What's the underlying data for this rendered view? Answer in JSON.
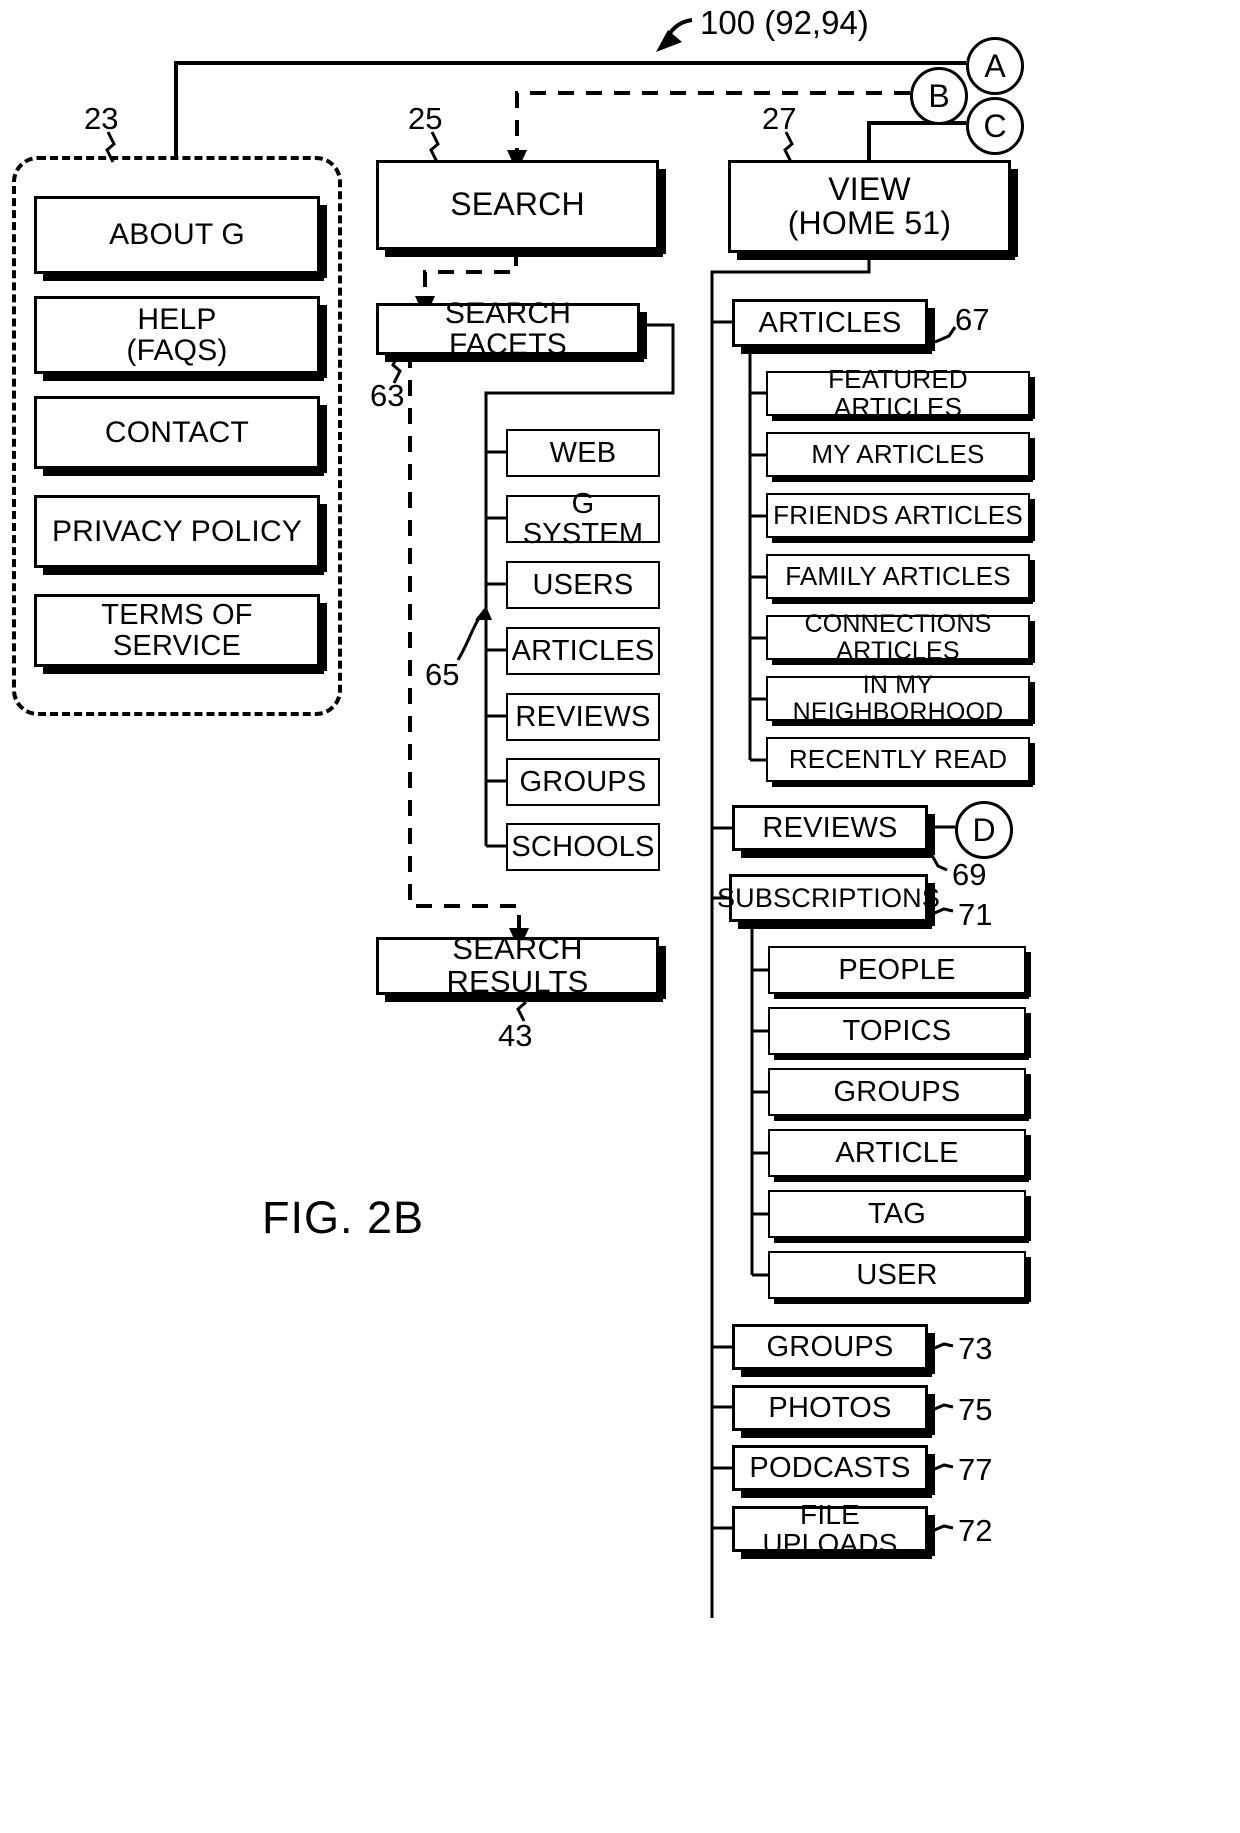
{
  "figure": {
    "label": "FIG. 2B",
    "top_reference": "100 (92,94)"
  },
  "connectors": [
    {
      "letter": "A"
    },
    {
      "letter": "B"
    },
    {
      "letter": "C"
    },
    {
      "letter": "D"
    }
  ],
  "reference_numerals": {
    "static_pages_group": "23",
    "search": "25",
    "view": "27",
    "search_facets": "63",
    "facet_list": "65",
    "articles": "67",
    "reviews": "69",
    "subscriptions": "71",
    "file_uploads": "72",
    "groups": "73",
    "photos": "75",
    "podcasts": "77",
    "search_results": "43"
  },
  "static_pages": {
    "items": [
      {
        "label": "ABOUT G"
      },
      {
        "label": "HELP\n(FAQS)"
      },
      {
        "label": "CONTACT"
      },
      {
        "label": "PRIVACY POLICY"
      },
      {
        "label": "TERMS OF SERVICE"
      }
    ]
  },
  "search_branch": {
    "search": "SEARCH",
    "search_facets": "SEARCH FACETS",
    "search_results": "SEARCH RESULTS",
    "facets": [
      {
        "label": "WEB"
      },
      {
        "label": "G SYSTEM"
      },
      {
        "label": "USERS"
      },
      {
        "label": "ARTICLES"
      },
      {
        "label": "REVIEWS"
      },
      {
        "label": "GROUPS"
      },
      {
        "label": "SCHOOLS"
      }
    ]
  },
  "view_branch": {
    "view": "VIEW\n(HOME 51)",
    "articles": "ARTICLES",
    "article_items": [
      {
        "label": "FEATURED ARTICLES"
      },
      {
        "label": "MY ARTICLES"
      },
      {
        "label": "FRIENDS ARTICLES"
      },
      {
        "label": "FAMILY ARTICLES"
      },
      {
        "label": "CONNECTIONS ARTICLES"
      },
      {
        "label": "IN MY NEIGHBORHOOD"
      },
      {
        "label": "RECENTLY READ"
      }
    ],
    "reviews": "REVIEWS",
    "subscriptions": "SUBSCRIPTIONS",
    "subscription_items": [
      {
        "label": "PEOPLE"
      },
      {
        "label": "TOPICS"
      },
      {
        "label": "GROUPS"
      },
      {
        "label": "ARTICLE"
      },
      {
        "label": "TAG"
      },
      {
        "label": "USER"
      }
    ],
    "bottom_items": [
      {
        "label": "GROUPS"
      },
      {
        "label": "PHOTOS"
      },
      {
        "label": "PODCASTS"
      },
      {
        "label": "FILE UPLOADS"
      }
    ]
  }
}
